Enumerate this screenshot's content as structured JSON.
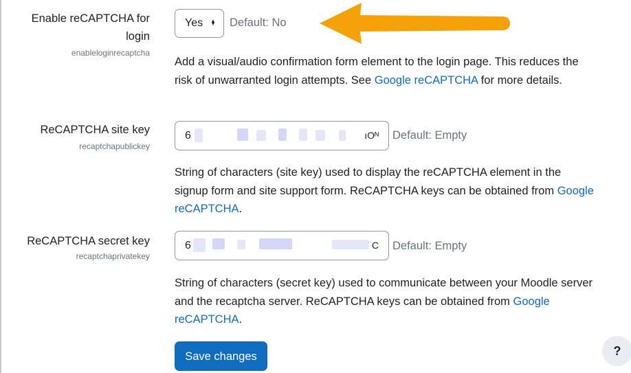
{
  "settings": [
    {
      "label_line1": "Enable reCAPTCHA for",
      "label_line2": "login",
      "name": "enableloginrecaptcha",
      "select_value": "Yes",
      "default": "Default: No",
      "desc_before": "Add a visual/audio confirmation form element to the login page. This reduces the risk of unwarranted login attempts. See ",
      "desc_link": "Google reCAPTCHA",
      "desc_after": " for more details."
    },
    {
      "label": "ReCAPTCHA site key",
      "name": "recaptchapublickey",
      "value_start": "6",
      "value_end": "ıOᴺ",
      "default": "Default: Empty",
      "desc_before": "String of characters (site key) used to display the reCAPTCHA element in the signup form and site support form. ReCAPTCHA keys can be obtained from ",
      "desc_link": "Google reCAPTCHA",
      "desc_after": "."
    },
    {
      "label": "ReCAPTCHA secret key",
      "name": "recaptchaprivatekey",
      "value_start": "6",
      "value_end": "C",
      "default": "Default: Empty",
      "desc_before": "String of characters (secret key) used to communicate between your Moodle server and the recaptcha server. ReCAPTCHA keys can be obtained from ",
      "desc_link": "Google reCAPTCHA",
      "desc_after": "."
    }
  ],
  "save_label": "Save changes",
  "help_label": "?",
  "colors": {
    "link": "#0f6cbf",
    "primary_button": "#0f6cbf",
    "arrow": "#f5a20a"
  },
  "icons": {
    "select_caret": "chevron-updown-icon",
    "annotation": "orange-arrow-icon"
  }
}
